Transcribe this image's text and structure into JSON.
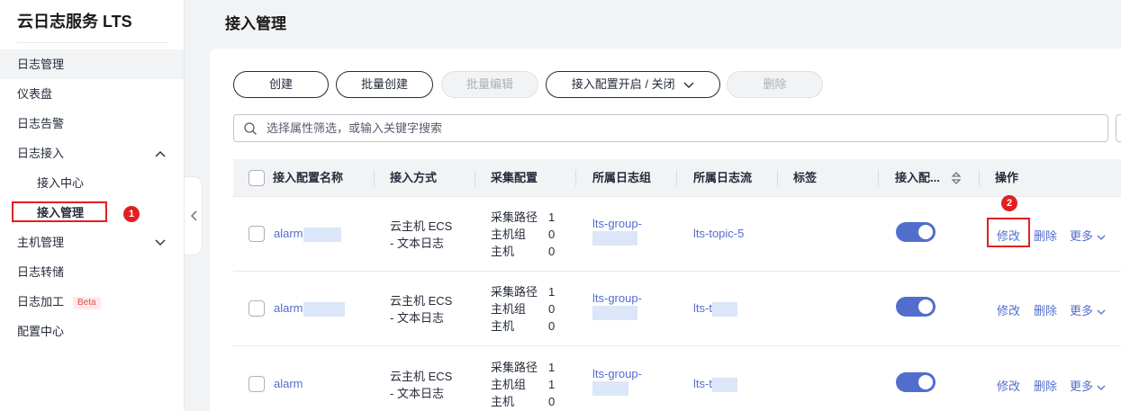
{
  "sidebar": {
    "title": "云日志服务 LTS",
    "items": [
      {
        "label": "日志管理"
      },
      {
        "label": "仪表盘"
      },
      {
        "label": "日志告警"
      },
      {
        "label": "日志接入"
      },
      {
        "label": "接入中心"
      },
      {
        "label": "接入管理"
      },
      {
        "label": "主机管理"
      },
      {
        "label": "日志转储"
      },
      {
        "label": "日志加工"
      },
      {
        "label": "配置中心"
      }
    ],
    "beta_label": "Beta"
  },
  "annotations": {
    "step1": "1",
    "step2": "2"
  },
  "page": {
    "title": "接入管理"
  },
  "toolbar": {
    "create": "创建",
    "batch_create": "批量创建",
    "batch_edit": "批量编辑",
    "toggle_config": "接入配置开启 / 关闭",
    "delete": "删除"
  },
  "search": {
    "placeholder": "选择属性筛选，或输入关键字搜索"
  },
  "table": {
    "headers": {
      "name": "接入配置名称",
      "method": "接入方式",
      "collect": "采集配置",
      "group": "所属日志组",
      "stream": "所属日志流",
      "tags": "标签",
      "status": "接入配...",
      "actions": "操作"
    },
    "collect_labels": [
      "采集路径",
      "主机组",
      "主机"
    ],
    "actions": {
      "modify": "修改",
      "delete": "删除",
      "more": "更多"
    },
    "rows": [
      {
        "name": "alarm",
        "method_line1": "云主机 ECS",
        "method_line2": "- 文本日志",
        "collect_values": [
          "1",
          "0",
          "0"
        ],
        "group": "lts-group-",
        "stream": "lts-topic-5",
        "enabled": true
      },
      {
        "name": "alarm",
        "method_line1": "云主机 ECS",
        "method_line2": "- 文本日志",
        "collect_values": [
          "1",
          "0",
          "0"
        ],
        "group": "lts-group-",
        "stream": "lts-t",
        "enabled": true
      },
      {
        "name": "alarm",
        "method_line1": "云主机 ECS",
        "method_line2": "- 文本日志",
        "collect_values": [
          "1",
          "1",
          "0"
        ],
        "group": "lts-group-",
        "stream": "lts-t",
        "enabled": true
      }
    ]
  },
  "colors": {
    "accent": "#526ecc",
    "highlight": "#e02020"
  }
}
